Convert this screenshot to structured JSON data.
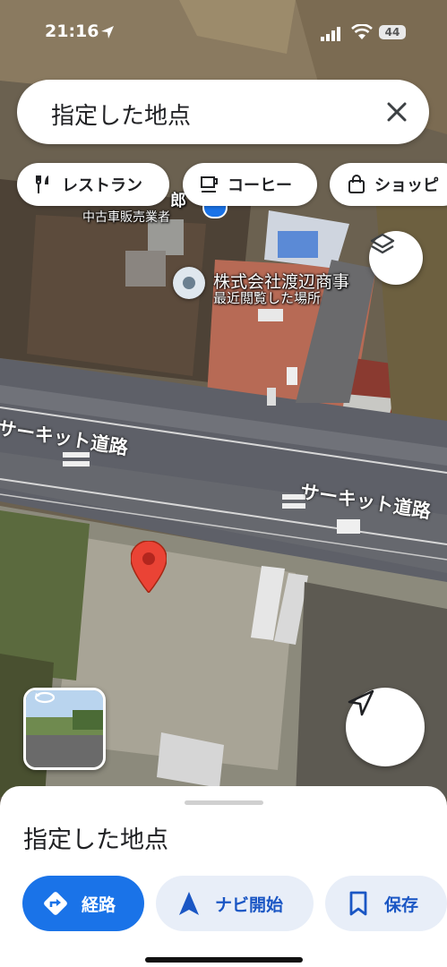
{
  "status_bar": {
    "time": "21:16",
    "battery": "44"
  },
  "search": {
    "query": "指定した地点"
  },
  "chips": [
    {
      "label": "レストラン",
      "icon": "fork-knife-icon"
    },
    {
      "label": "コーヒー",
      "icon": "coffee-icon"
    },
    {
      "label": "ショッピ",
      "icon": "shopping-bag-icon"
    }
  ],
  "map": {
    "partial_label_top": "郎",
    "dealer_label": "中古車販売業者",
    "place": {
      "name": "株式会社渡辺商事",
      "sub": "最近閲覧した場所"
    },
    "road_label_left": "サーキット道路",
    "road_label_right": "サーキット道路"
  },
  "sheet": {
    "title": "指定した地点",
    "buttons": {
      "route": "経路",
      "navigate": "ナビ開始",
      "save": "保存"
    }
  },
  "colors": {
    "accent": "#1a73e8",
    "pin": "#ea4335"
  }
}
